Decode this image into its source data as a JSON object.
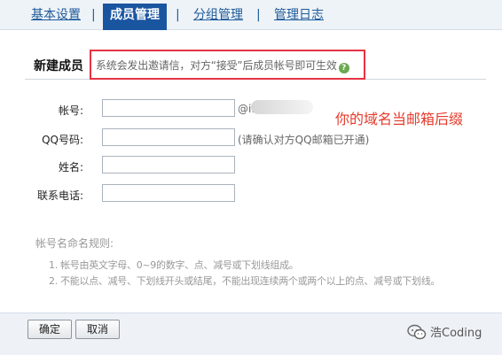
{
  "tabs": [
    {
      "label": "基本设置",
      "active": false
    },
    {
      "label": "成员管理",
      "active": true
    },
    {
      "label": "分组管理",
      "active": false
    },
    {
      "label": "管理日志",
      "active": false
    }
  ],
  "tab_separator": "|",
  "section": {
    "title": "新建成员",
    "hint": "系统会发出邀请信，对方“接受”后成员帐号即可生效",
    "help_icon": "?"
  },
  "form": {
    "account_label": "帐号:",
    "account_suffix": "@i.",
    "qq_label": "QQ号码:",
    "qq_suffix": "(请确认对方QQ邮箱已开通)",
    "name_label": "姓名:",
    "phone_label": "联系电话:"
  },
  "annotation": "你的域名当邮箱后缀",
  "rules": {
    "title": "帐号名命名规则:",
    "items": [
      "1. 帐号由英文字母、0~9的数字、点、减号或下划线组成。",
      "2. 不能以点、减号、下划线开头或结尾，不能出现连续两个或两个以上的点、减号或下划线。"
    ]
  },
  "footer": {
    "confirm_label": "确定",
    "cancel_label": "取消",
    "watermark": "浩Coding"
  },
  "colors": {
    "active_tab": "#1a55a0",
    "link": "#1d5a99",
    "highlight_border": "#e53344",
    "annotation": "#e53b2c"
  }
}
